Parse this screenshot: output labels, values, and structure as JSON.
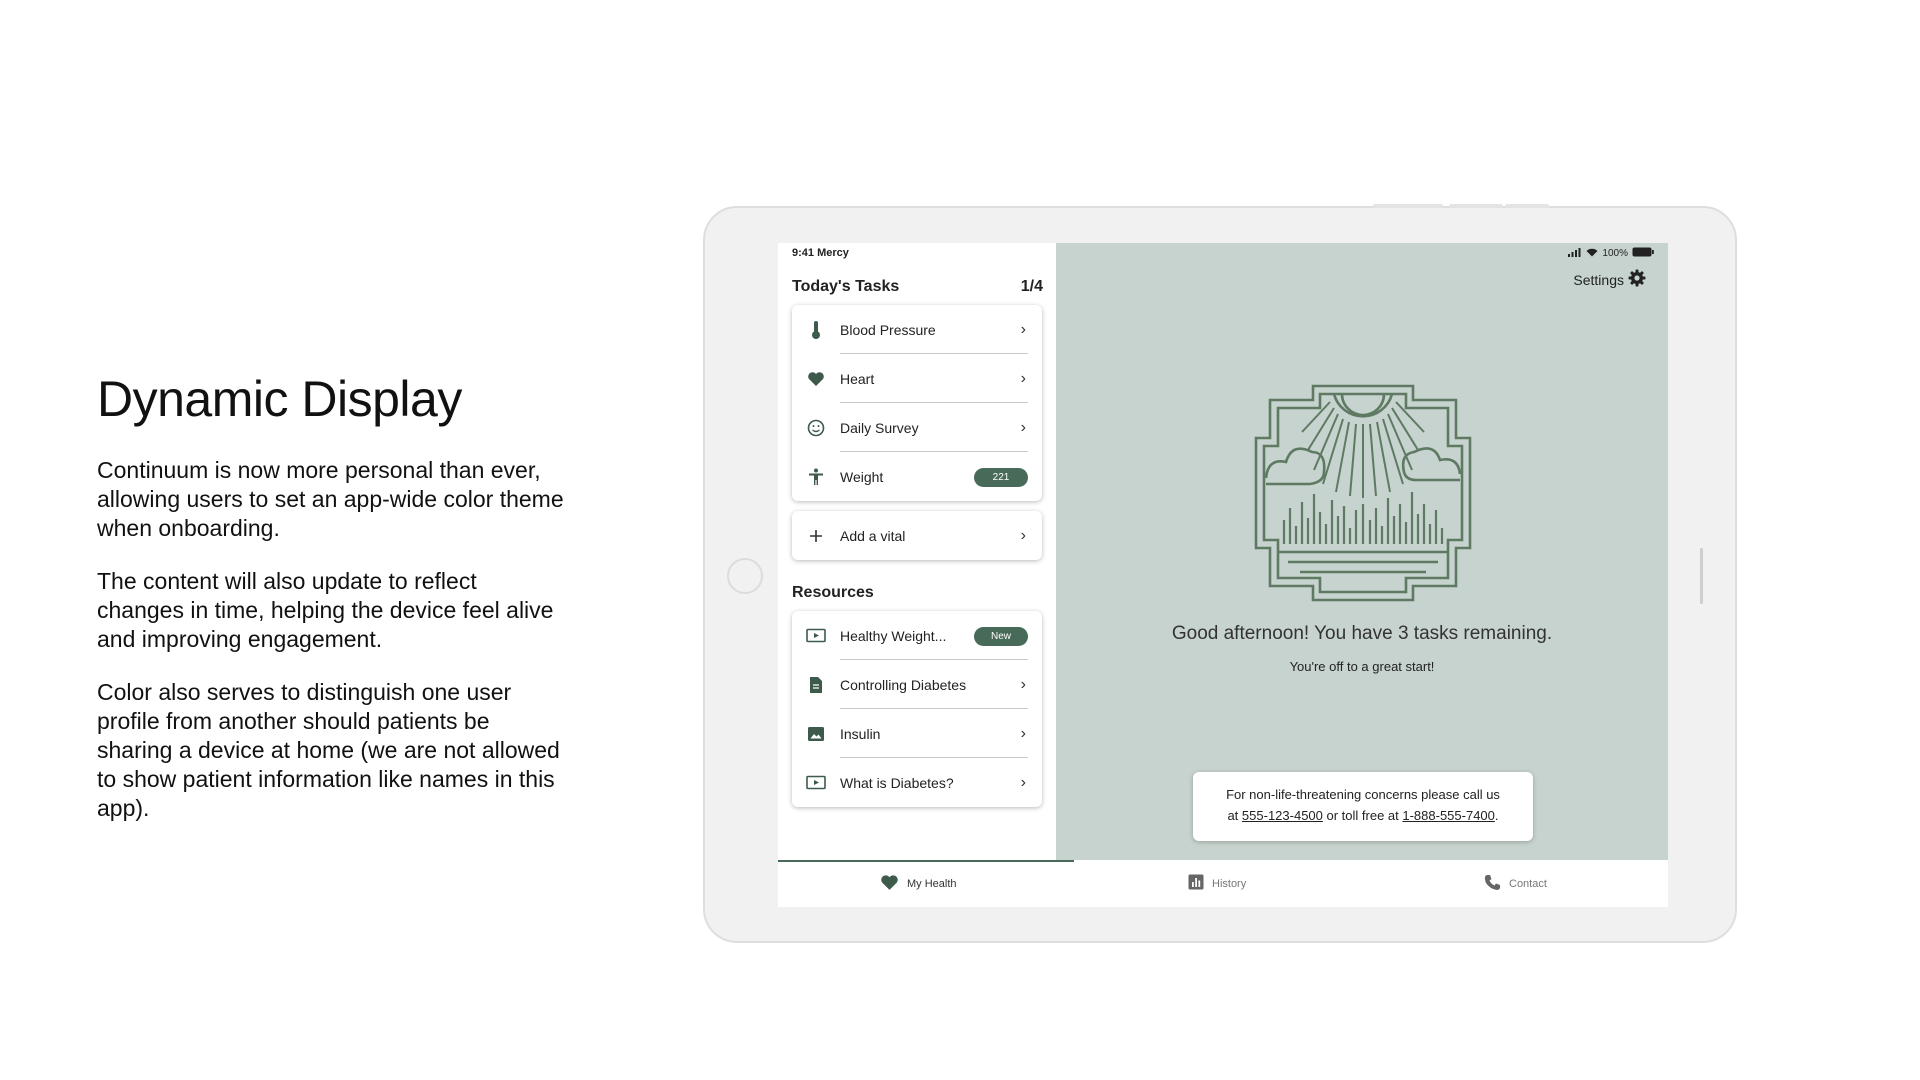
{
  "slide": {
    "title": "Dynamic Display",
    "paragraphs": [
      "Continuum is now more personal than ever, allowing users to set an app-wide color theme when onboarding.",
      "The content will also update to reflect changes in time, helping the device feel alive and improving engagement.",
      "Color also serves to distinguish one user profile from another should patients be sharing a device at home (we are not allowed to show patient information like names in this app)."
    ]
  },
  "status_bar": {
    "time_carrier": "9:41  Mercy",
    "battery": "100%"
  },
  "tasks": {
    "heading": "Today's Tasks",
    "count": "1/4",
    "items": [
      {
        "label": "Blood Pressure",
        "icon": "thermometer-icon"
      },
      {
        "label": "Heart",
        "icon": "heart-icon"
      },
      {
        "label": "Daily Survey",
        "icon": "smiley-icon"
      },
      {
        "label": "Weight",
        "icon": "person-icon",
        "badge": "221"
      }
    ],
    "add_vital": "Add a vital"
  },
  "resources": {
    "heading": "Resources",
    "items": [
      {
        "label": "Healthy Weight...",
        "icon": "video-icon",
        "badge": "New"
      },
      {
        "label": "Controlling Diabetes",
        "icon": "document-icon"
      },
      {
        "label": "Insulin",
        "icon": "image-icon"
      },
      {
        "label": "What is Diabetes?",
        "icon": "video-icon"
      }
    ]
  },
  "main": {
    "settings_label": "Settings",
    "greeting": "Good afternoon!  You have 3 tasks remaining.",
    "subtext": "You're off to a great start!",
    "notice_line1": "For non-life-threatening concerns please call us",
    "notice_prefix": "at ",
    "phone_local": "555-123-4500",
    "notice_mid": " or toll free at ",
    "phone_tollfree": "1-888-555-7400",
    "notice_suffix": "."
  },
  "tabs": [
    {
      "label": "My Health",
      "icon": "heart-icon",
      "active": true
    },
    {
      "label": "History",
      "icon": "chart-icon",
      "active": false
    },
    {
      "label": "Contact",
      "icon": "phone-icon",
      "active": false
    }
  ],
  "colors": {
    "theme_accent": "#486a58",
    "theme_background": "#c7d3ce",
    "emblem": "#5f7a63"
  }
}
